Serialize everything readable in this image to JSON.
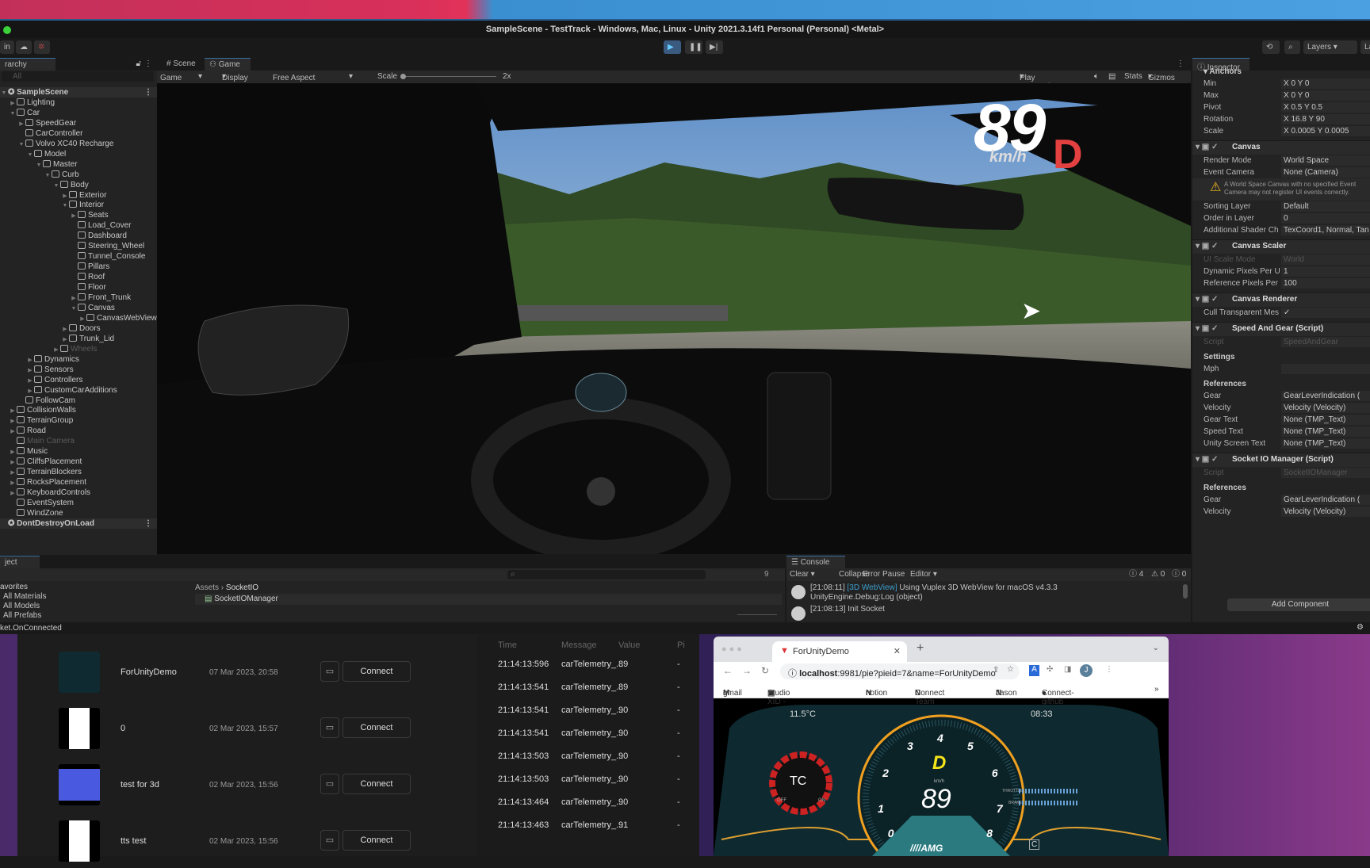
{
  "window": {
    "title": "SampleScene - TestTrack - Windows, Mac, Linux - Unity 2021.3.14f1 Personal (Personal) <Metal>"
  },
  "toolbar": {
    "account_label": "in",
    "layers_label": "Layers",
    "layout_label": "La",
    "play_icon": "play-icon",
    "pause_icon": "pause-icon",
    "step_icon": "step-icon"
  },
  "hierarchy": {
    "tab": "rarchy",
    "search_placeholder": "All",
    "items": [
      {
        "label": "SampleScene",
        "level": 0,
        "arrow": "e",
        "kind": "scene"
      },
      {
        "label": "Lighting",
        "level": 1,
        "arrow": "c"
      },
      {
        "label": "Car",
        "level": 1,
        "arrow": "e"
      },
      {
        "label": "SpeedGear",
        "level": 2,
        "arrow": "c"
      },
      {
        "label": "CarController",
        "level": 2,
        "arrow": ""
      },
      {
        "label": "Volvo XC40 Recharge",
        "level": 2,
        "arrow": "e"
      },
      {
        "label": "Model",
        "level": 3,
        "arrow": "e"
      },
      {
        "label": "Master",
        "level": 4,
        "arrow": "e"
      },
      {
        "label": "Curb",
        "level": 5,
        "arrow": "e"
      },
      {
        "label": "Body",
        "level": 6,
        "arrow": "e"
      },
      {
        "label": "Exterior",
        "level": 7,
        "arrow": "c"
      },
      {
        "label": "Interior",
        "level": 7,
        "arrow": "e"
      },
      {
        "label": "Seats",
        "level": 8,
        "arrow": "c"
      },
      {
        "label": "Load_Cover",
        "level": 8,
        "arrow": ""
      },
      {
        "label": "Dashboard",
        "level": 8,
        "arrow": ""
      },
      {
        "label": "Steering_Wheel",
        "level": 8,
        "arrow": ""
      },
      {
        "label": "Tunnel_Console",
        "level": 8,
        "arrow": ""
      },
      {
        "label": "Pillars",
        "level": 8,
        "arrow": ""
      },
      {
        "label": "Roof",
        "level": 8,
        "arrow": ""
      },
      {
        "label": "Floor",
        "level": 8,
        "arrow": ""
      },
      {
        "label": "Front_Trunk",
        "level": 8,
        "arrow": "c"
      },
      {
        "label": "Canvas",
        "level": 8,
        "arrow": "e",
        "kind": "selected"
      },
      {
        "label": "CanvasWebView",
        "level": 9,
        "arrow": "c"
      },
      {
        "label": "Doors",
        "level": 7,
        "arrow": "c"
      },
      {
        "label": "Trunk_Lid",
        "level": 7,
        "arrow": "c"
      },
      {
        "label": "Wheels",
        "level": 6,
        "arrow": "c",
        "kind": "dim"
      },
      {
        "label": "Dynamics",
        "level": 3,
        "arrow": "c"
      },
      {
        "label": "Sensors",
        "level": 3,
        "arrow": "c"
      },
      {
        "label": "Controllers",
        "level": 3,
        "arrow": "c"
      },
      {
        "label": "CustomCarAdditions",
        "level": 3,
        "arrow": "c"
      },
      {
        "label": "FollowCam",
        "level": 2,
        "arrow": ""
      },
      {
        "label": "CollisionWalls",
        "level": 1,
        "arrow": "c"
      },
      {
        "label": "TerrainGroup",
        "level": 1,
        "arrow": "c"
      },
      {
        "label": "Road",
        "level": 1,
        "arrow": "c"
      },
      {
        "label": "Main Camera",
        "level": 1,
        "arrow": "",
        "kind": "dim"
      },
      {
        "label": "Music",
        "level": 1,
        "arrow": "c"
      },
      {
        "label": "CliffsPlacement",
        "level": 1,
        "arrow": "c"
      },
      {
        "label": "TerrainBlockers",
        "level": 1,
        "arrow": "c"
      },
      {
        "label": "RocksPlacement",
        "level": 1,
        "arrow": "c"
      },
      {
        "label": "KeyboardControls",
        "level": 1,
        "arrow": "c"
      },
      {
        "label": "EventSystem",
        "level": 1,
        "arrow": ""
      },
      {
        "label": "WindZone",
        "level": 1,
        "arrow": ""
      },
      {
        "label": "DontDestroyOnLoad",
        "level": 0,
        "arrow": "",
        "kind": "scene"
      }
    ]
  },
  "game": {
    "tab_scene": "Scene",
    "tab_game": "Game",
    "mode": "Game",
    "display": "Display 1",
    "aspect": "Free Aspect",
    "scale_label": "Scale",
    "scale_value": "2x",
    "play_focused": "Play Focused",
    "stats": "Stats",
    "gizmos": "Gizmos",
    "hud": {
      "speed": "89",
      "unit": "km/h",
      "gear": "D"
    }
  },
  "inspector": {
    "tab": "Inspector",
    "add_component": "Add Component",
    "rows": [
      {
        "t": "sec",
        "label": "▾ Anchors"
      },
      {
        "t": "f",
        "label": "Min",
        "value": "X 0      Y 0"
      },
      {
        "t": "f",
        "label": "Max",
        "value": "X 0      Y 0"
      },
      {
        "t": "f",
        "label": "Pivot",
        "value": "X 0.5    Y 0.5"
      },
      {
        "t": "f",
        "label": "Rotation",
        "value": "X 16.8   Y 90"
      },
      {
        "t": "f",
        "label": "Scale",
        "value": "X 0.0005 Y 0.0005"
      },
      {
        "t": "h",
        "label": "Canvas"
      },
      {
        "t": "f",
        "label": "Render Mode",
        "value": "World Space"
      },
      {
        "t": "f",
        "label": "Event Camera",
        "value": "None (Camera)"
      },
      {
        "t": "w",
        "label": "A World Space Canvas with no specified Event Camera may not register UI events correctly."
      },
      {
        "t": "f",
        "label": "Sorting Layer",
        "value": "Default"
      },
      {
        "t": "f",
        "label": "Order in Layer",
        "value": "0"
      },
      {
        "t": "f",
        "label": "Additional Shader Ch",
        "value": "TexCoord1, Normal, Tan"
      },
      {
        "t": "h",
        "label": "Canvas Scaler"
      },
      {
        "t": "d",
        "label": "UI Scale Mode",
        "value": "World"
      },
      {
        "t": "f",
        "label": "Dynamic Pixels Per U",
        "value": "1"
      },
      {
        "t": "f",
        "label": "Reference Pixels Per",
        "value": "100"
      },
      {
        "t": "h",
        "label": "Canvas Renderer"
      },
      {
        "t": "f",
        "label": "Cull Transparent Mes",
        "value": "✓"
      },
      {
        "t": "h",
        "label": "Speed And Gear (Script)"
      },
      {
        "t": "d",
        "label": "Script",
        "value": "SpeedAndGear"
      },
      {
        "t": "sec",
        "label": "Settings"
      },
      {
        "t": "f",
        "label": "Mph",
        "value": ""
      },
      {
        "t": "sec",
        "label": "References"
      },
      {
        "t": "f",
        "label": "Gear",
        "value": "GearLeverIndication ("
      },
      {
        "t": "f",
        "label": "Velocity",
        "value": "Velocity (Velocity)"
      },
      {
        "t": "f",
        "label": "Gear Text",
        "value": "None (TMP_Text)"
      },
      {
        "t": "f",
        "label": "Speed Text",
        "value": "None (TMP_Text)"
      },
      {
        "t": "f",
        "label": "Unity Screen Text",
        "value": "None (TMP_Text)"
      },
      {
        "t": "h",
        "label": "Socket IO Manager (Script)"
      },
      {
        "t": "d",
        "label": "Script",
        "value": "SocketIOManager"
      },
      {
        "t": "sec",
        "label": "References"
      },
      {
        "t": "f",
        "label": "Gear",
        "value": "GearLeverIndication ("
      },
      {
        "t": "f",
        "label": "Velocity",
        "value": "Velocity (Velocity)"
      }
    ]
  },
  "project": {
    "tab": "ject",
    "favorites": "avorites",
    "fav_items": [
      "All Materials",
      "All Models",
      "All Prefabs"
    ],
    "breadcrumb_root": "Assets",
    "breadcrumb_folder": "SocketIO",
    "file": "SocketIOManager",
    "hidden_count": "9"
  },
  "console": {
    "tab": "Console",
    "clear": "Clear",
    "collapse": "Collapse",
    "error_pause": "Error Pause",
    "editor": "Editor",
    "count_log": "4",
    "count_warn": "0",
    "count_err": "0",
    "entries": [
      {
        "time": "[21:08:11]",
        "tag": "[3D WebView]",
        "msg": "Using Vuplex 3D WebView for macOS v4.3.3",
        "sub": "UnityEngine.Debug:Log (object)"
      },
      {
        "time": "[21:08:13]",
        "tag": "",
        "msg": "Init Socket",
        "sub": ""
      }
    ]
  },
  "status": {
    "text": "ket.OnConnected"
  },
  "app": {
    "connect_label": "Connect",
    "projects": [
      {
        "name": "ForUnityDemo",
        "date": "07 Mar 2023, 20:58"
      },
      {
        "name": "0",
        "date": "02 Mar 2023, 15:57"
      },
      {
        "name": "test for 3d",
        "date": "02 Mar 2023, 15:56"
      },
      {
        "name": "tts test",
        "date": "02 Mar 2023, 15:56"
      }
    ],
    "telemetry": {
      "headers": [
        "Time",
        "Message",
        "Value",
        "Pi"
      ],
      "rows": [
        {
          "time": "21:14:13:596",
          "msg": "carTelemetry_...",
          "value": "89",
          "p": "-"
        },
        {
          "time": "21:14:13:541",
          "msg": "carTelemetry_...",
          "value": "89",
          "p": "-"
        },
        {
          "time": "21:14:13:541",
          "msg": "carTelemetry_...",
          "value": "90",
          "p": "-"
        },
        {
          "time": "21:14:13:541",
          "msg": "carTelemetry_...",
          "value": "90",
          "p": "-"
        },
        {
          "time": "21:14:13:503",
          "msg": "carTelemetry_...",
          "value": "90",
          "p": "-"
        },
        {
          "time": "21:14:13:503",
          "msg": "carTelemetry_...",
          "value": "90",
          "p": "-"
        },
        {
          "time": "21:14:13:464",
          "msg": "carTelemetry_...",
          "value": "90",
          "p": "-"
        },
        {
          "time": "21:14:13:463",
          "msg": "carTelemetry_...",
          "value": "91",
          "p": "-"
        }
      ]
    }
  },
  "browser": {
    "tab_title": "ForUnityDemo",
    "url_host": "localhost",
    "url_rest": ":9981/pie?pieid=7&name=ForUnityDemo",
    "avatar": "J",
    "bookmarks": [
      "gmail",
      "Studio XID - 캘린더...",
      "notion",
      "Connect Team",
      "Jason",
      "Connect-github"
    ],
    "dash": {
      "temp": "11.5°C",
      "clock": "08:33",
      "gear": "D",
      "unit": "km/h",
      "speed": "89",
      "ticks": [
        "0",
        "1",
        "2",
        "3",
        "4",
        "5",
        "6",
        "7",
        "8"
      ],
      "tc": "TC",
      "off": "OFF",
      "on": "ON",
      "throttle": "THROTTLE",
      "brake": "BRAKE",
      "brand": "////AMG",
      "mode": "C"
    },
    "colors": {
      "accent": "#f0a020",
      "gear": "#f5e51a"
    }
  }
}
